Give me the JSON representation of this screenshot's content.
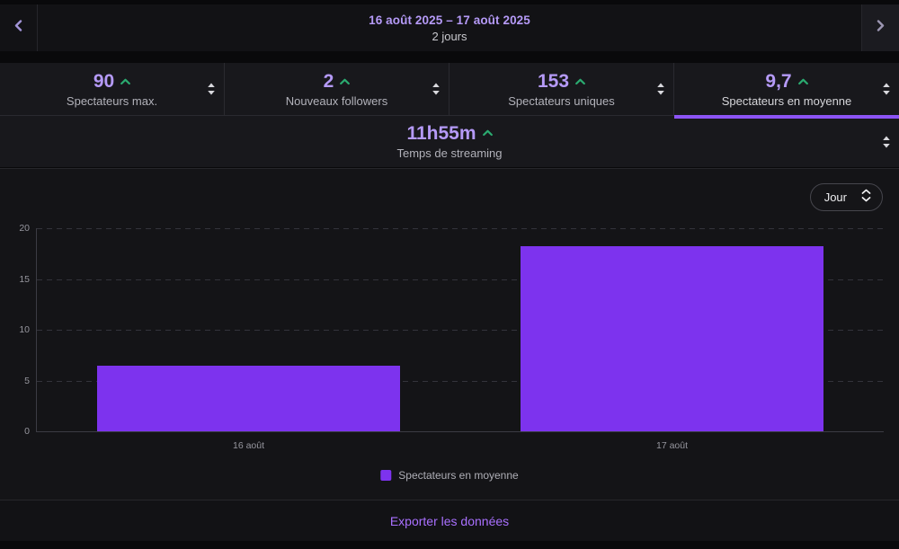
{
  "nav": {
    "title": "16 août 2025 – 17 août 2025",
    "subtitle": "2 jours"
  },
  "stats": {
    "cards": [
      {
        "value": "90",
        "label": "Spectateurs max."
      },
      {
        "value": "2",
        "label": "Nouveaux followers"
      },
      {
        "value": "153",
        "label": "Spectateurs uniques"
      },
      {
        "value": "9,7",
        "label": "Spectateurs en moyenne"
      }
    ],
    "selected_index": 3,
    "extra_card": {
      "value": "11h55m",
      "label": "Temps de streaming"
    }
  },
  "period_select": {
    "value": "Jour"
  },
  "chart_data": {
    "type": "bar",
    "categories": [
      "16 août",
      "17 août"
    ],
    "series": [
      {
        "name": "Spectateurs en moyenne",
        "values": [
          6.5,
          18.2
        ],
        "color": "#7d33ee"
      }
    ],
    "ylim": [
      0,
      20
    ],
    "yticks": [
      0,
      5,
      10,
      15,
      20
    ],
    "grid": "horizontal-dashed",
    "legend_position": "bottom",
    "bar_width_pct": 35.7
  },
  "footer": {
    "export_label": "Exporter les données"
  },
  "colors": {
    "accent_purple": "#b59af7",
    "bar_purple": "#7d33ee",
    "trend_green": "#2bab70",
    "link_purple": "#a970ff",
    "selected_underline": "#8c54f5"
  }
}
